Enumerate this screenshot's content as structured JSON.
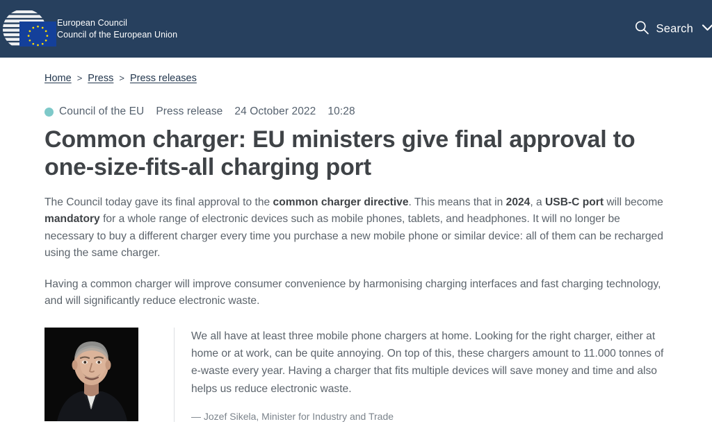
{
  "header": {
    "logo_icon": "council-europa-building-logo",
    "eu_flag_icon": "eu-flag-icon",
    "brand_line1": "European Council",
    "brand_line2": "Council of the European Union",
    "search_icon": "search-icon",
    "search_label": "Search",
    "chevron_icon": "chevron-down-icon",
    "background_color": "#27405e"
  },
  "breadcrumb": {
    "items": [
      {
        "label": "Home"
      },
      {
        "label": "Press"
      },
      {
        "label": "Press releases"
      }
    ],
    "separator": ">"
  },
  "article": {
    "meta": {
      "dot_color": "#7ec9c9",
      "source": "Council of the EU",
      "type": "Press release",
      "date": "24 October 2022",
      "time": "10:28"
    },
    "headline": "Common charger: EU ministers give final approval to one-size-fits-all charging port",
    "paragraph_1": {
      "segments": [
        {
          "text": "The Council today gave its final approval to the ",
          "bold": false
        },
        {
          "text": "common charger directive",
          "bold": true
        },
        {
          "text": ". This means that in ",
          "bold": false
        },
        {
          "text": "2024",
          "bold": true
        },
        {
          "text": ", a ",
          "bold": false
        },
        {
          "text": "USB-C port",
          "bold": true
        },
        {
          "text": " will become ",
          "bold": false
        },
        {
          "text": "mandatory",
          "bold": true
        },
        {
          "text": " for a whole range of electronic devices such as mobile phones, tablets, and headphones. It will no longer be necessary to buy a different charger every time you purchase a new mobile phone or similar device: all of them can be recharged using the same charger.",
          "bold": false
        }
      ]
    },
    "paragraph_2": "Having a common charger will improve consumer convenience by harmonising charging interfaces and fast charging technology, and will significantly reduce electronic waste.",
    "quote": {
      "portrait_alt": "portrait-of-jozef-sikela",
      "text": "We all have at least three mobile phone chargers at home. Looking for the right charger, either at home or at work, can be quite annoying. On top of this, these chargers amount to 11.000 tonnes of e-waste every year. Having a charger that fits multiple devices will save money and time and also helps us reduce electronic waste.",
      "attribution": "— Jozef Sikela, Minister for Industry and Trade"
    }
  }
}
